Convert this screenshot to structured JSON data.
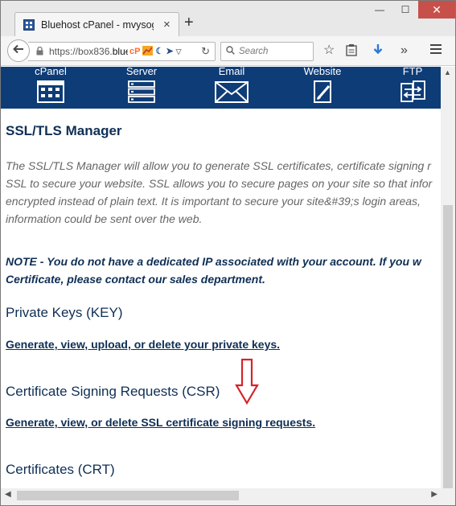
{
  "browser": {
    "tab_title": "Bluehost cPanel - mvysogo...",
    "tab_close": "×",
    "new_tab": "+",
    "url_prefix": "https://box836.",
    "url_host": "bluel",
    "search_placeholder": "Search",
    "window_minimize": "—",
    "window_maximize": "☐",
    "window_close": "✕"
  },
  "cpanel_nav": [
    {
      "label": "cPanel",
      "icon": "cpanel-grid-icon"
    },
    {
      "label": "Server",
      "icon": "server-stack-icon"
    },
    {
      "label": "Email",
      "icon": "envelope-icon"
    },
    {
      "label": "Website",
      "icon": "website-edit-icon"
    },
    {
      "label": "FTP",
      "icon": "ftp-transfer-icon"
    }
  ],
  "page": {
    "title": "SSL/TLS Manager",
    "intro_lines": [
      "The SSL/TLS Manager will allow you to generate SSL certificates, certificate signing r",
      "SSL to secure your website. SSL allows you to secure pages on your site so that infor",
      "encrypted instead of plain text. It is important to secure your site&#39;s login areas,",
      "information could be sent over the web."
    ],
    "note_lines": [
      "NOTE - You do not have a dedicated IP associated with your account. If you w",
      "Certificate, please contact our sales department."
    ],
    "sections": [
      {
        "heading": "Private Keys (KEY)",
        "link": "Generate, view, upload, or delete your private keys."
      },
      {
        "heading": "Certificate Signing Requests (CSR)",
        "link": "Generate, view, or delete SSL certificate signing requests."
      },
      {
        "heading": "Certificates (CRT)",
        "link": ""
      }
    ]
  },
  "colors": {
    "header_bg": "#0e3c77",
    "text_dark_blue": "#0f2f55",
    "annotation_arrow": "#d6232a"
  }
}
